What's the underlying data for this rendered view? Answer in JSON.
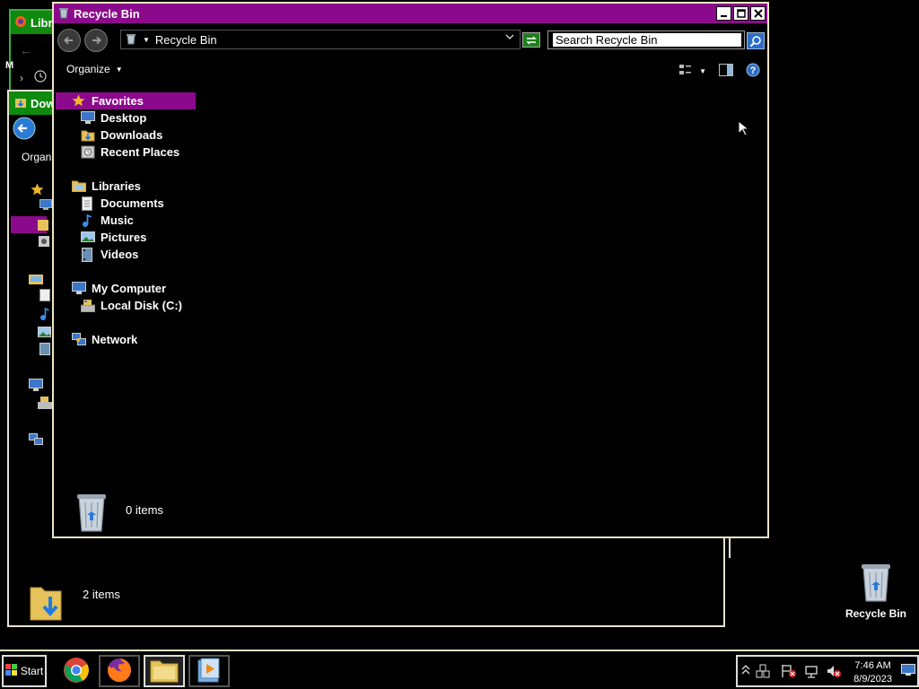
{
  "background_windows": {
    "libraries": {
      "title": "Libr",
      "menu_letter": "M"
    },
    "downloads": {
      "title": "Dow",
      "organize": "Organi",
      "status": "2 items"
    }
  },
  "main_window": {
    "title": "Recycle Bin",
    "title_buttons": [
      "minimize",
      "maximize",
      "close"
    ],
    "address": {
      "crumb": "Recycle Bin"
    },
    "search": {
      "placeholder": "Search Recycle Bin"
    },
    "toolbar": {
      "organize_label": "Organize"
    },
    "nav": {
      "favorites": {
        "label": "Favorites",
        "items": [
          {
            "label": "Desktop",
            "icon": "desktop-icon"
          },
          {
            "label": "Downloads",
            "icon": "downloads-folder-icon"
          },
          {
            "label": "Recent Places",
            "icon": "recent-places-icon"
          }
        ]
      },
      "libraries": {
        "label": "Libraries",
        "items": [
          {
            "label": "Documents",
            "icon": "documents-icon"
          },
          {
            "label": "Music",
            "icon": "music-icon"
          },
          {
            "label": "Pictures",
            "icon": "pictures-icon"
          },
          {
            "label": "Videos",
            "icon": "videos-icon"
          }
        ]
      },
      "computer": {
        "label": "My Computer",
        "items": [
          {
            "label": "Local Disk (C:)",
            "icon": "local-disk-icon"
          }
        ]
      },
      "network": {
        "label": "Network"
      }
    },
    "details": {
      "status": "0 items"
    }
  },
  "desktop": {
    "recycle_bin_label": "Recycle Bin"
  },
  "taskbar": {
    "start_label": "Start",
    "apps": [
      "chrome",
      "firefox",
      "file-explorer",
      "media-player"
    ],
    "clock": {
      "time": "7:46 AM",
      "date": "8/9/2023"
    }
  },
  "colors": {
    "title_bar": "#8b0a8b",
    "selection": "#8b0a8b",
    "bg_title": "#0f8a0f",
    "window_border": "#efe6c8"
  }
}
